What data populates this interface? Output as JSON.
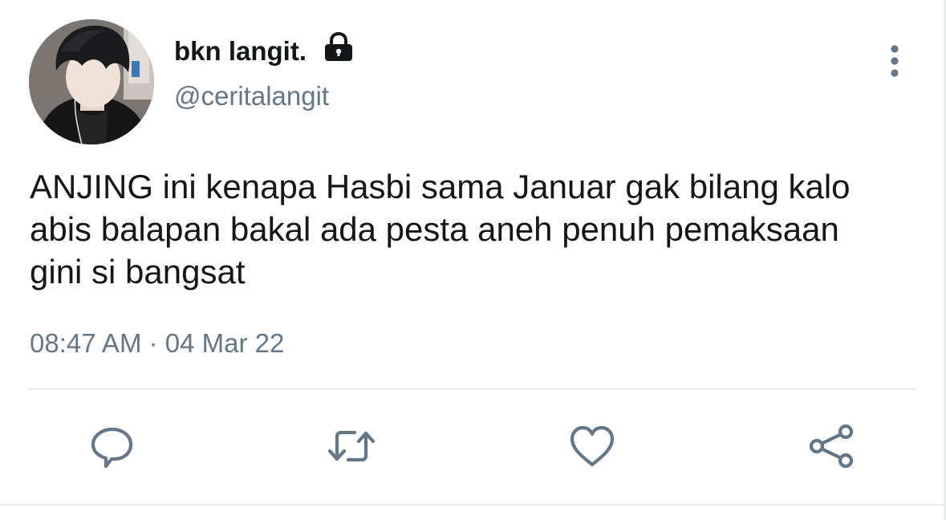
{
  "tweet": {
    "display_name": "bkn langit.",
    "handle": "@ceritalangit",
    "text": "ANJING ini kenapa Hasbi sama Januar gak bilang kalo abis balapan bakal ada pesta aneh penuh pemaksaan gini si bangsat",
    "timestamp": "08:47 AM · 04 Mar 22",
    "protected": true
  },
  "icons": {
    "lock": "lock-icon",
    "more": "more-vertical-icon",
    "reply": "reply-icon",
    "retweet": "retweet-icon",
    "like": "heart-icon",
    "share": "share-icon"
  },
  "colors": {
    "text_primary": "#14171a",
    "text_secondary": "#657786",
    "icon": "#657786",
    "divider": "#e6ecf0"
  }
}
